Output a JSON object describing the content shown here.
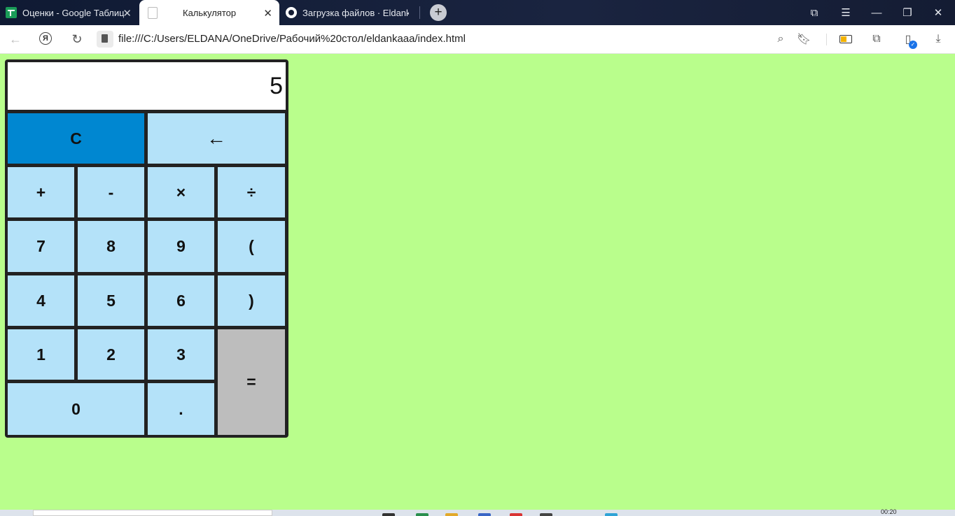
{
  "tabs": [
    {
      "title": "Оценки - Google Таблицы",
      "icon": "google-sheets-icon"
    },
    {
      "title": "Калькулятор",
      "icon": "page-icon",
      "active": true
    },
    {
      "title": "Загрузка файлов · Eldankaaa",
      "icon": "github-icon"
    }
  ],
  "tab_close_glyph": "✕",
  "new_tab_glyph": "+",
  "window_controls": {
    "collections": "⧉",
    "menu": "☰",
    "minimize": "—",
    "restore": "❐",
    "close": "✕"
  },
  "address_bar": {
    "url": "file:///C:/Users/ELDANA/OneDrive/Рабочий%20стол/eldankaaa/index.html",
    "yandex_glyph": "Я"
  },
  "calculator": {
    "display": "5",
    "keys": {
      "clear": "C",
      "backspace": "←",
      "plus": "+",
      "minus": "-",
      "multiply": "×",
      "divide": "÷",
      "d7": "7",
      "d8": "8",
      "d9": "9",
      "open_paren": "(",
      "d4": "4",
      "d5": "5",
      "d6": "6",
      "close_paren": ")",
      "d1": "1",
      "d2": "2",
      "d3": "3",
      "equals": "=",
      "d0": "0",
      "dot": "."
    }
  },
  "colors": {
    "page_bg": "#b9fe8c",
    "key_bg": "#b4e2f9",
    "clear_key": "#0087d1",
    "equals_key": "#bdbdbd",
    "grid": "#222222"
  },
  "taskbar": {
    "time": "00:20"
  }
}
